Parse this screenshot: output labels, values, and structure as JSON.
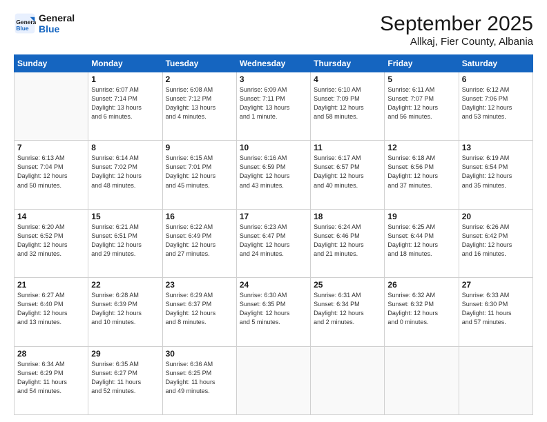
{
  "logo": {
    "line1": "General",
    "line2": "Blue"
  },
  "header": {
    "month": "September 2025",
    "location": "Allkaj, Fier County, Albania"
  },
  "weekdays": [
    "Sunday",
    "Monday",
    "Tuesday",
    "Wednesday",
    "Thursday",
    "Friday",
    "Saturday"
  ],
  "weeks": [
    [
      {
        "day": "",
        "detail": ""
      },
      {
        "day": "1",
        "detail": "Sunrise: 6:07 AM\nSunset: 7:14 PM\nDaylight: 13 hours\nand 6 minutes."
      },
      {
        "day": "2",
        "detail": "Sunrise: 6:08 AM\nSunset: 7:12 PM\nDaylight: 13 hours\nand 4 minutes."
      },
      {
        "day": "3",
        "detail": "Sunrise: 6:09 AM\nSunset: 7:11 PM\nDaylight: 13 hours\nand 1 minute."
      },
      {
        "day": "4",
        "detail": "Sunrise: 6:10 AM\nSunset: 7:09 PM\nDaylight: 12 hours\nand 58 minutes."
      },
      {
        "day": "5",
        "detail": "Sunrise: 6:11 AM\nSunset: 7:07 PM\nDaylight: 12 hours\nand 56 minutes."
      },
      {
        "day": "6",
        "detail": "Sunrise: 6:12 AM\nSunset: 7:06 PM\nDaylight: 12 hours\nand 53 minutes."
      }
    ],
    [
      {
        "day": "7",
        "detail": "Sunrise: 6:13 AM\nSunset: 7:04 PM\nDaylight: 12 hours\nand 50 minutes."
      },
      {
        "day": "8",
        "detail": "Sunrise: 6:14 AM\nSunset: 7:02 PM\nDaylight: 12 hours\nand 48 minutes."
      },
      {
        "day": "9",
        "detail": "Sunrise: 6:15 AM\nSunset: 7:01 PM\nDaylight: 12 hours\nand 45 minutes."
      },
      {
        "day": "10",
        "detail": "Sunrise: 6:16 AM\nSunset: 6:59 PM\nDaylight: 12 hours\nand 43 minutes."
      },
      {
        "day": "11",
        "detail": "Sunrise: 6:17 AM\nSunset: 6:57 PM\nDaylight: 12 hours\nand 40 minutes."
      },
      {
        "day": "12",
        "detail": "Sunrise: 6:18 AM\nSunset: 6:56 PM\nDaylight: 12 hours\nand 37 minutes."
      },
      {
        "day": "13",
        "detail": "Sunrise: 6:19 AM\nSunset: 6:54 PM\nDaylight: 12 hours\nand 35 minutes."
      }
    ],
    [
      {
        "day": "14",
        "detail": "Sunrise: 6:20 AM\nSunset: 6:52 PM\nDaylight: 12 hours\nand 32 minutes."
      },
      {
        "day": "15",
        "detail": "Sunrise: 6:21 AM\nSunset: 6:51 PM\nDaylight: 12 hours\nand 29 minutes."
      },
      {
        "day": "16",
        "detail": "Sunrise: 6:22 AM\nSunset: 6:49 PM\nDaylight: 12 hours\nand 27 minutes."
      },
      {
        "day": "17",
        "detail": "Sunrise: 6:23 AM\nSunset: 6:47 PM\nDaylight: 12 hours\nand 24 minutes."
      },
      {
        "day": "18",
        "detail": "Sunrise: 6:24 AM\nSunset: 6:46 PM\nDaylight: 12 hours\nand 21 minutes."
      },
      {
        "day": "19",
        "detail": "Sunrise: 6:25 AM\nSunset: 6:44 PM\nDaylight: 12 hours\nand 18 minutes."
      },
      {
        "day": "20",
        "detail": "Sunrise: 6:26 AM\nSunset: 6:42 PM\nDaylight: 12 hours\nand 16 minutes."
      }
    ],
    [
      {
        "day": "21",
        "detail": "Sunrise: 6:27 AM\nSunset: 6:40 PM\nDaylight: 12 hours\nand 13 minutes."
      },
      {
        "day": "22",
        "detail": "Sunrise: 6:28 AM\nSunset: 6:39 PM\nDaylight: 12 hours\nand 10 minutes."
      },
      {
        "day": "23",
        "detail": "Sunrise: 6:29 AM\nSunset: 6:37 PM\nDaylight: 12 hours\nand 8 minutes."
      },
      {
        "day": "24",
        "detail": "Sunrise: 6:30 AM\nSunset: 6:35 PM\nDaylight: 12 hours\nand 5 minutes."
      },
      {
        "day": "25",
        "detail": "Sunrise: 6:31 AM\nSunset: 6:34 PM\nDaylight: 12 hours\nand 2 minutes."
      },
      {
        "day": "26",
        "detail": "Sunrise: 6:32 AM\nSunset: 6:32 PM\nDaylight: 12 hours\nand 0 minutes."
      },
      {
        "day": "27",
        "detail": "Sunrise: 6:33 AM\nSunset: 6:30 PM\nDaylight: 11 hours\nand 57 minutes."
      }
    ],
    [
      {
        "day": "28",
        "detail": "Sunrise: 6:34 AM\nSunset: 6:29 PM\nDaylight: 11 hours\nand 54 minutes."
      },
      {
        "day": "29",
        "detail": "Sunrise: 6:35 AM\nSunset: 6:27 PM\nDaylight: 11 hours\nand 52 minutes."
      },
      {
        "day": "30",
        "detail": "Sunrise: 6:36 AM\nSunset: 6:25 PM\nDaylight: 11 hours\nand 49 minutes."
      },
      {
        "day": "",
        "detail": ""
      },
      {
        "day": "",
        "detail": ""
      },
      {
        "day": "",
        "detail": ""
      },
      {
        "day": "",
        "detail": ""
      }
    ]
  ]
}
